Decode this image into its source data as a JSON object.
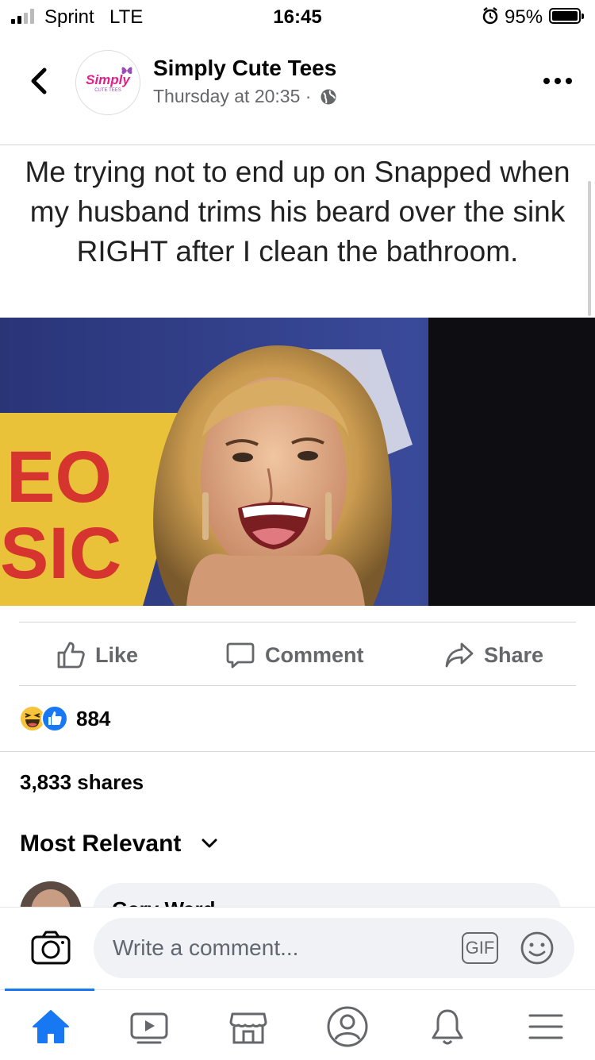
{
  "status_bar": {
    "carrier": "Sprint",
    "network": "LTE",
    "time": "16:45",
    "battery": "95%",
    "icons": [
      "signal-icon",
      "alarm-icon",
      "battery-icon"
    ]
  },
  "header": {
    "page_name": "Simply Cute Tees",
    "timestamp": "Thursday at 20:35 ·",
    "avatar_logo": "Simply",
    "avatar_sub": "CUTE TEES"
  },
  "post": {
    "caption_lines": [
      "Me trying not to end up on Snapped when",
      "my husband trims his beard over the sink",
      "RIGHT after I clean the bathroom."
    ],
    "photo_sign_text_1": "EO",
    "photo_sign_text_2": "SIC"
  },
  "actions": {
    "like": "Like",
    "comment": "Comment",
    "share": "Share"
  },
  "engagement": {
    "reaction_count": "884",
    "shares": "3,833 shares"
  },
  "comments": {
    "sort_label": "Most Relevant",
    "first_commenter": "Gary Ward"
  },
  "composer": {
    "placeholder": "Write a comment...",
    "gif_label": "GIF"
  },
  "colors": {
    "accent": "#1877f2",
    "muted": "#65676b",
    "divider": "#d4d6da"
  }
}
